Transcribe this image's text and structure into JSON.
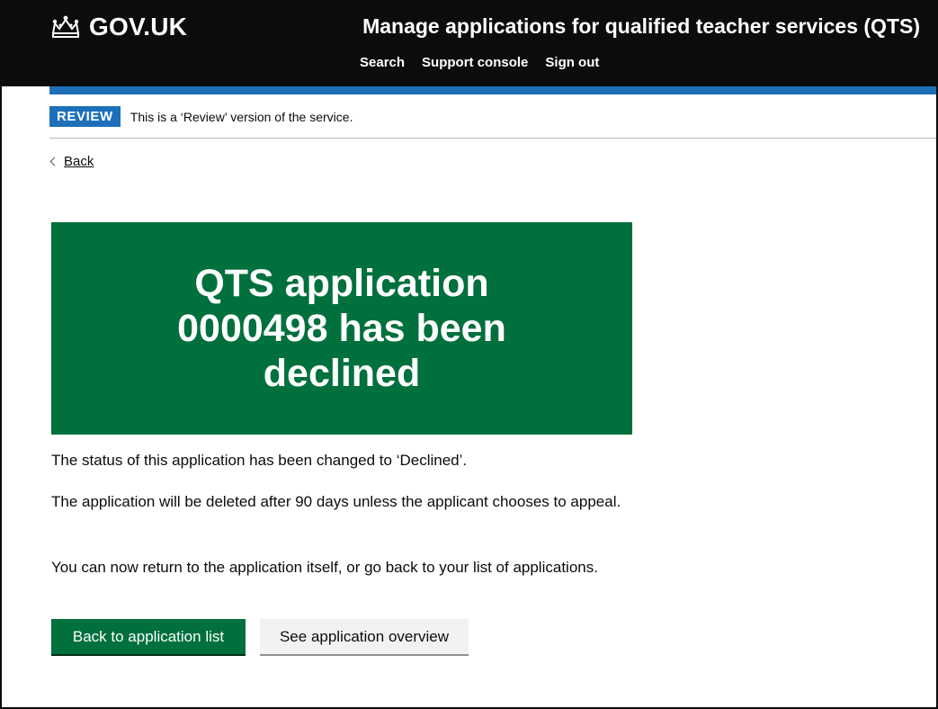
{
  "header": {
    "logo_text": "GOV.UK",
    "service_name": "Manage applications for qualified teacher services (QTS)",
    "nav": [
      "Search",
      "Support console",
      "Sign out"
    ]
  },
  "phase_banner": {
    "tag": "REVIEW",
    "text": "This is a ‘Review’ version of the service."
  },
  "back_link": "Back",
  "panel": {
    "title": "QTS application 0000498 has been declined"
  },
  "body": {
    "paragraphs": [
      "The status of this application has been changed to ‘Declined’.",
      "The application will be deleted after 90 days unless the applicant chooses to appeal.",
      "You can now return to the application itself, or go back to your list of applications."
    ]
  },
  "buttons": {
    "primary": "Back to application list",
    "secondary": "See application overview"
  },
  "colors": {
    "header_bg": "#0b0c0c",
    "accent_blue": "#1d70b8",
    "success_green": "#00703c",
    "secondary_button": "#f3f2f1"
  },
  "icons": {
    "logo": "crown-icon",
    "back": "chevron-left-icon"
  }
}
